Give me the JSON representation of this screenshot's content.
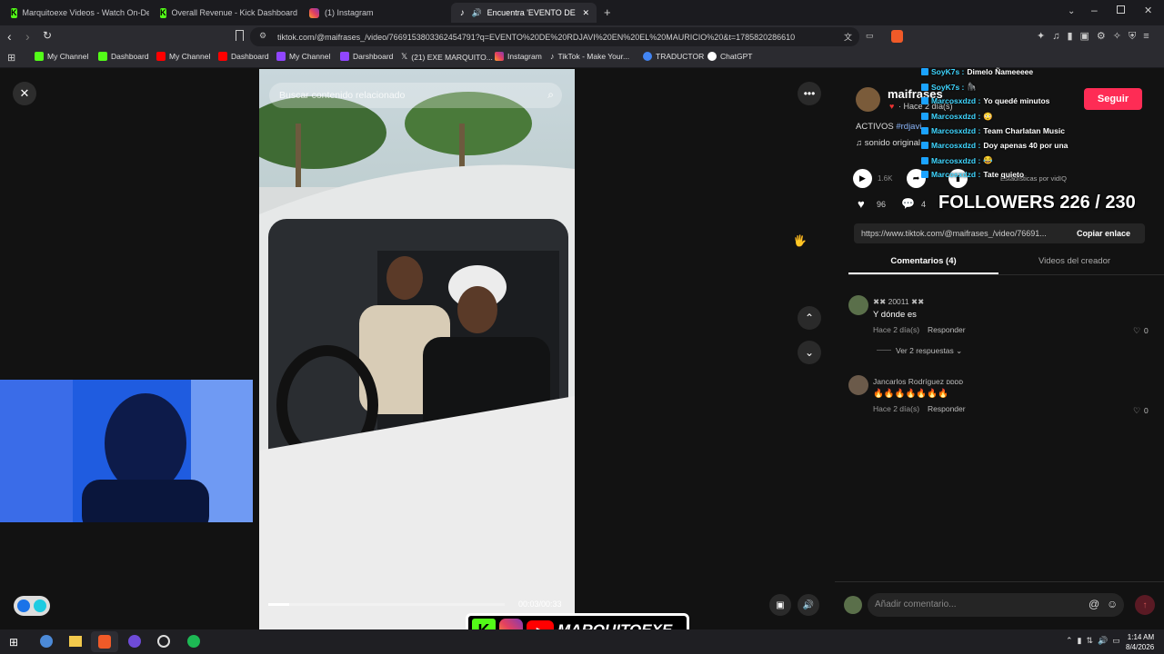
{
  "tabs": [
    {
      "label": "Marquitoexe Videos - Watch On-Dem",
      "fav": "k"
    },
    {
      "label": "Overall Revenue - Kick Dashboard",
      "fav": "k"
    },
    {
      "label": "(1) Instagram",
      "fav": "ig"
    },
    {
      "label": "Encuentra 'EVENTO DE RDJAV",
      "fav": "tt"
    }
  ],
  "address": {
    "url": "tiktok.com/@maifrases_/video/7669153803362454791?q=EVENTO%20DE%20RDJAVI%20EN%20EL%20MAURICIO%20&t=1785820286610"
  },
  "bookmarks": [
    {
      "label": "My Channel",
      "color": "#53fc18"
    },
    {
      "label": "Dashboard",
      "color": "#53fc18"
    },
    {
      "label": "My Channel",
      "color": "#ff0000"
    },
    {
      "label": "Dashboard",
      "color": "#ff0000"
    },
    {
      "label": "My Channel",
      "color": "#9146ff"
    },
    {
      "label": "Darshboard",
      "color": "#9146ff"
    },
    {
      "label": "(21) EXE MARQUITO...",
      "color": "#000000"
    },
    {
      "label": "Instagram",
      "color": "#e4405f"
    },
    {
      "label": "TikTok - Make Your...",
      "color": "#000000"
    },
    {
      "label": "TRADUCTOR",
      "color": "#4285f4"
    },
    {
      "label": "ChatGPT",
      "color": "#ffffff"
    }
  ],
  "video": {
    "search_placeholder": "Buscar contenido relacionado",
    "time": "00:03/00:33",
    "progress": 0.09
  },
  "post": {
    "username": "maifrases",
    "meta": "· Hace 2 día(s)",
    "caption": "ACTIVOS",
    "hashtag": "#rdjavi",
    "sound": "sonido original",
    "follow": "Seguir",
    "views": "1.6K",
    "stats_label": "Estadísticas por vidIQ",
    "likes": "96",
    "comments": "4",
    "link": "https://www.tiktok.com/@maifrases_/video/76691...",
    "copy": "Copiar enlace"
  },
  "followers": "FOLLOWERS 226 / 230",
  "chat": [
    {
      "user": "SoyK7s :",
      "msg": "Dimelo Ñameeeee"
    },
    {
      "user": "SoyK7s :",
      "msg": "🦍"
    },
    {
      "user": "Marcosxdzd :",
      "msg": "Yo quedé minutos"
    },
    {
      "user": "Marcosxdzd :",
      "msg": "😳"
    },
    {
      "user": "Marcosxdzd :",
      "msg": "Team Charlatan Music"
    },
    {
      "user": "Marcosxdzd :",
      "msg": "Doy apenas 40 por una"
    },
    {
      "user": "Marcosxdzd :",
      "msg": "😂"
    },
    {
      "user": "Marcosxdzd :",
      "msg": "Tate quieto"
    }
  ],
  "tabs_panel": {
    "comments": "Comentarios (4)",
    "creator": "Videos del creador"
  },
  "comments": [
    {
      "name": "✖✖ 20011 ✖✖",
      "text": "Y dónde es",
      "time": "Hace 2 día(s)",
      "reply": "Responder",
      "likes": "0",
      "replies": "Ver 2 respuestas"
    },
    {
      "name": "Jancarlos Rodríguez ᴅᴅᴅᴅ",
      "text": "🔥🔥🔥🔥🔥🔥🔥",
      "time": "Hace 2 día(s)",
      "reply": "Responder",
      "likes": "0"
    }
  ],
  "comment_input": {
    "placeholder": "Añadir comentario..."
  },
  "overlay": {
    "brand": "MARQUITOEXE"
  },
  "clock": {
    "time": "1:14 AM",
    "date": "8/4/2026"
  }
}
